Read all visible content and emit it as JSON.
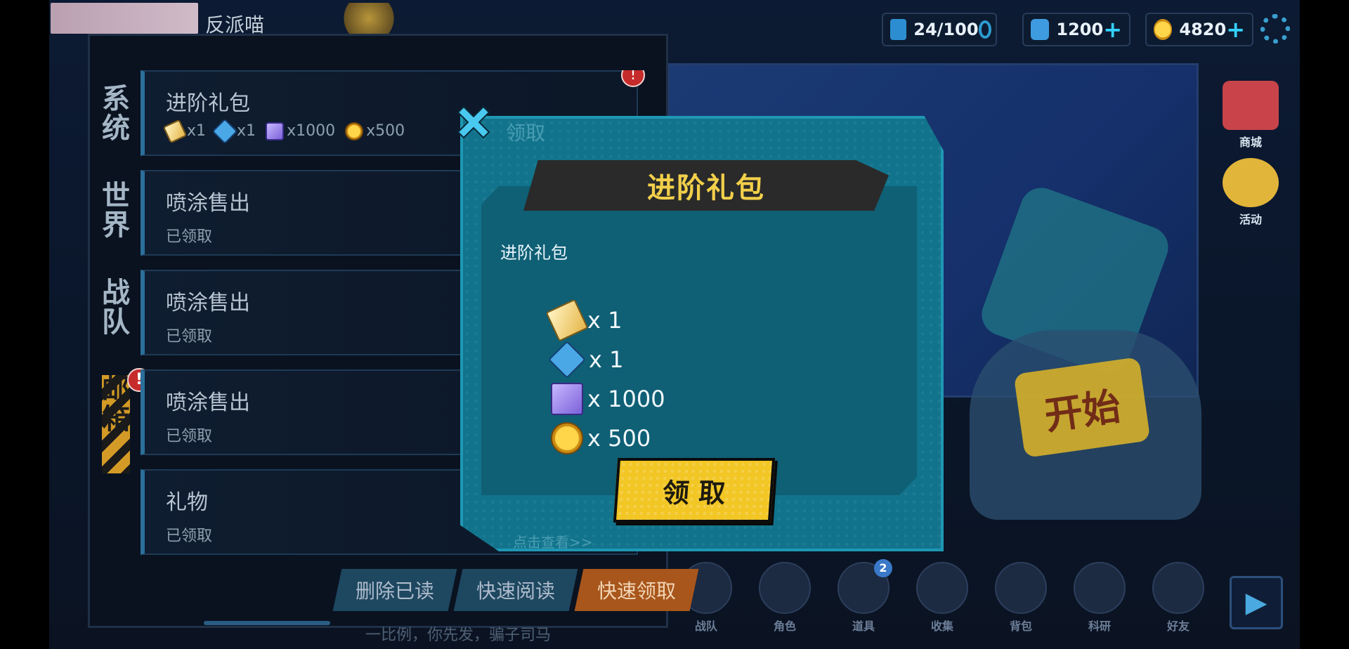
{
  "topbar": {
    "player_name": "反派喵",
    "stamina": "24/100",
    "gems": "1200",
    "coins": "4820"
  },
  "side_icons": [
    "商城",
    "活动"
  ],
  "start_label": "开始",
  "bottom_nav": [
    {
      "label": "战队"
    },
    {
      "label": "角色"
    },
    {
      "label": "道具",
      "badge": "2"
    },
    {
      "label": "收集"
    },
    {
      "label": "背包"
    },
    {
      "label": "科研"
    },
    {
      "label": "好友"
    }
  ],
  "mail": {
    "tabs": [
      "系统",
      "世界",
      "战队",
      "邮箱"
    ],
    "items": [
      {
        "title": "进阶礼包",
        "rewards": [
          "x1",
          "x1",
          "x1000",
          "x500"
        ]
      },
      {
        "title": "喷涂售出",
        "status": "已领取"
      },
      {
        "title": "喷涂售出",
        "status": "已领取"
      },
      {
        "title": "喷涂售出",
        "status": "已领取"
      },
      {
        "title": "礼物",
        "status": "已领取"
      }
    ],
    "buttons": {
      "delete_read": "删除已读",
      "quick_read": "快速阅读",
      "quick_claim": "快速领取"
    },
    "footer_text": "一比例，你先发，骗子司马"
  },
  "modal": {
    "title": "进阶礼包",
    "description": "进阶礼包",
    "rewards": [
      {
        "icon": "ticket-icon",
        "qty": "x 1"
      },
      {
        "icon": "mystery-box-icon",
        "qty": "x 1"
      },
      {
        "icon": "cube-icon",
        "qty": "x 1000"
      },
      {
        "icon": "coin-icon",
        "qty": "x 500"
      }
    ],
    "claim_label": "领 取",
    "background_claim_text": "领取",
    "view_link": "点击查看>>"
  }
}
